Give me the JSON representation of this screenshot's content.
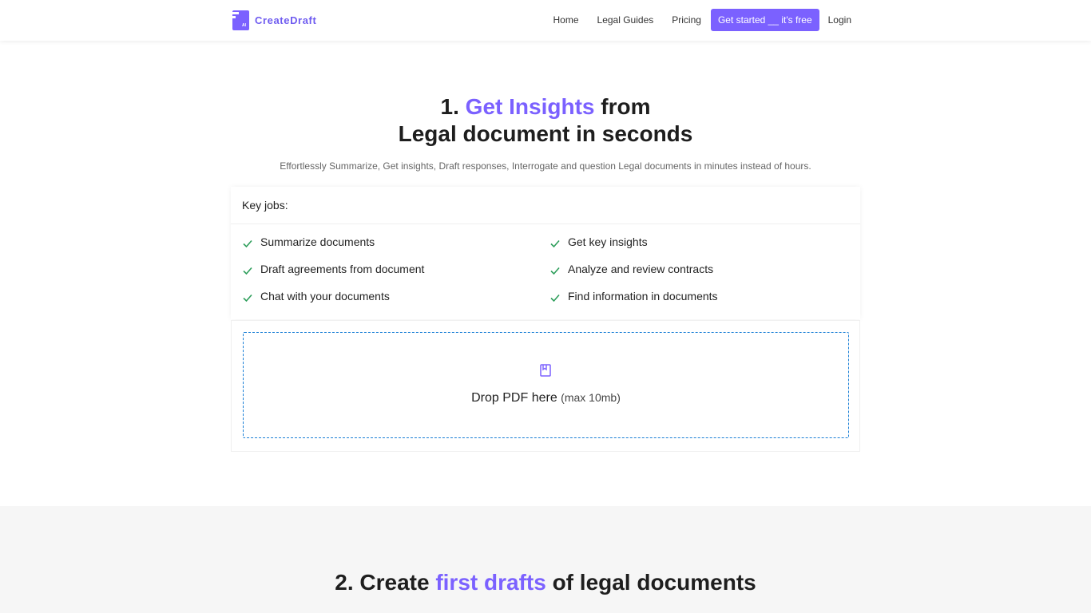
{
  "nav": {
    "brand": "CreateDraft",
    "logo_ai": "AI",
    "links": [
      "Home",
      "Legal Guides",
      "Pricing"
    ],
    "cta": "Get started __ it's free",
    "login": "Login"
  },
  "hero": {
    "title_prefix": "1. ",
    "title_accent": "Get Insights",
    "title_suffix": " from",
    "title_line2": "Legal document in seconds",
    "subtitle": "Effortlessly Summarize, Get insights, Draft responses, Interrogate and question Legal documents in minutes instead of hours."
  },
  "key_jobs": {
    "header": "Key jobs:",
    "left": [
      "Summarize documents",
      "Draft agreements from document",
      "Chat with your documents"
    ],
    "right": [
      "Get key insights",
      "Analyze and review contracts",
      "Find information in documents"
    ]
  },
  "dropzone": {
    "icon": "document-icon",
    "label": "Drop PDF here",
    "limit": "(max 10mb)"
  },
  "section2": {
    "prefix": "2. Create ",
    "accent": "first drafts",
    "suffix": " of legal documents"
  },
  "colors": {
    "accent": "#7b61ff",
    "check": "#2e9e5b",
    "dropzone_border": "#1a7fd6"
  }
}
